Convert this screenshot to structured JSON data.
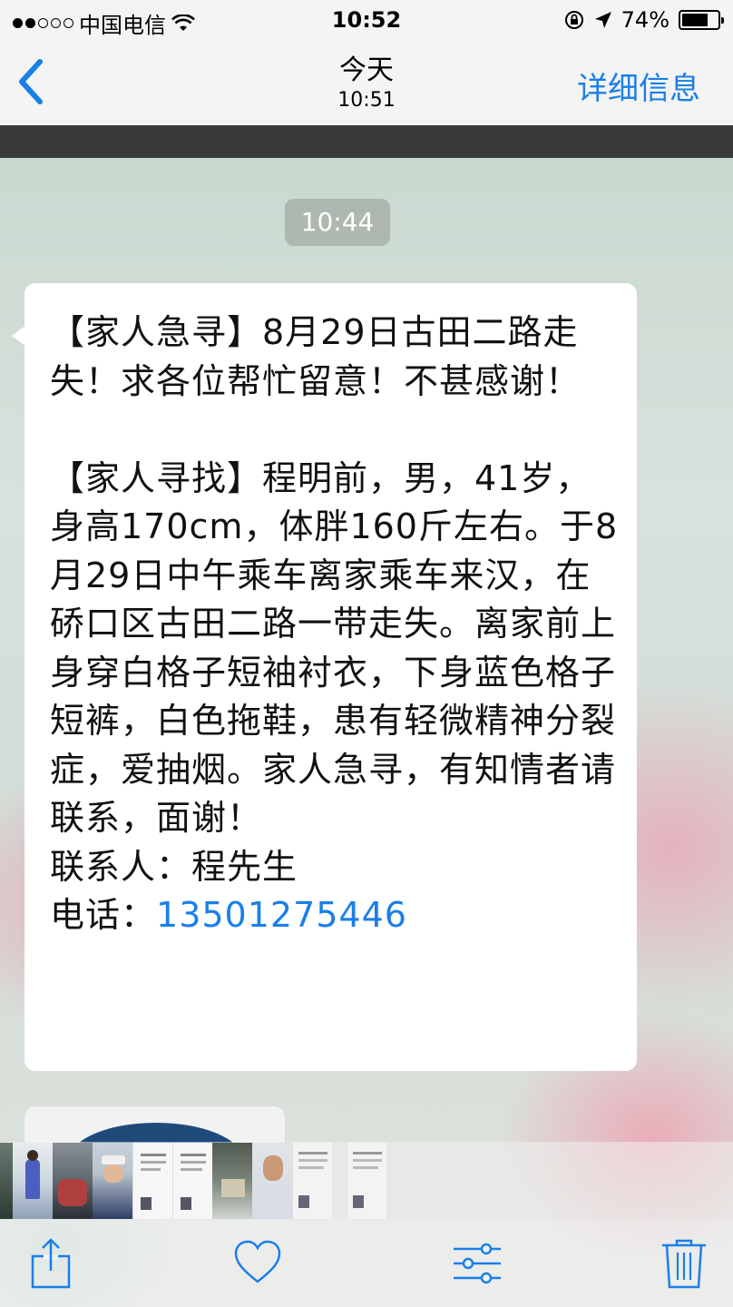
{
  "status_bar": {
    "carrier": "中国电信",
    "time": "10:52",
    "battery_percent": "74%",
    "battery_level": 0.74
  },
  "nav": {
    "title": "今天",
    "subtitle": "10:51",
    "details_label": "详细信息"
  },
  "conversation": {
    "timestamp": "10:44",
    "message_text": "【家人急寻】8月29日古田二路走失！求各位帮忙留意！不甚感谢！\n\n【家人寻找】程明前，男，41岁，身高170cm，体胖160斤左右。于8月29日中午乘车离家乘车来汉，在硚口区古田二路一带走失。离家前上身穿白格子短袖衬衣，下身蓝色格子短裤，白色拖鞋，患有轻微精神分裂症，爱抽烟。家人急寻，有知情者请联系，面谢！\n联系人：程先生\n电话：",
    "phone_number": "13501275446"
  },
  "colors": {
    "accent": "#1b7fe8",
    "nav_background": "#f4f4f4",
    "bubble_background": "#ffffff"
  },
  "toolbar": {
    "share_icon": "share-icon",
    "favorite_icon": "heart-icon",
    "adjust_icon": "sliders-icon",
    "delete_icon": "trash-icon"
  }
}
